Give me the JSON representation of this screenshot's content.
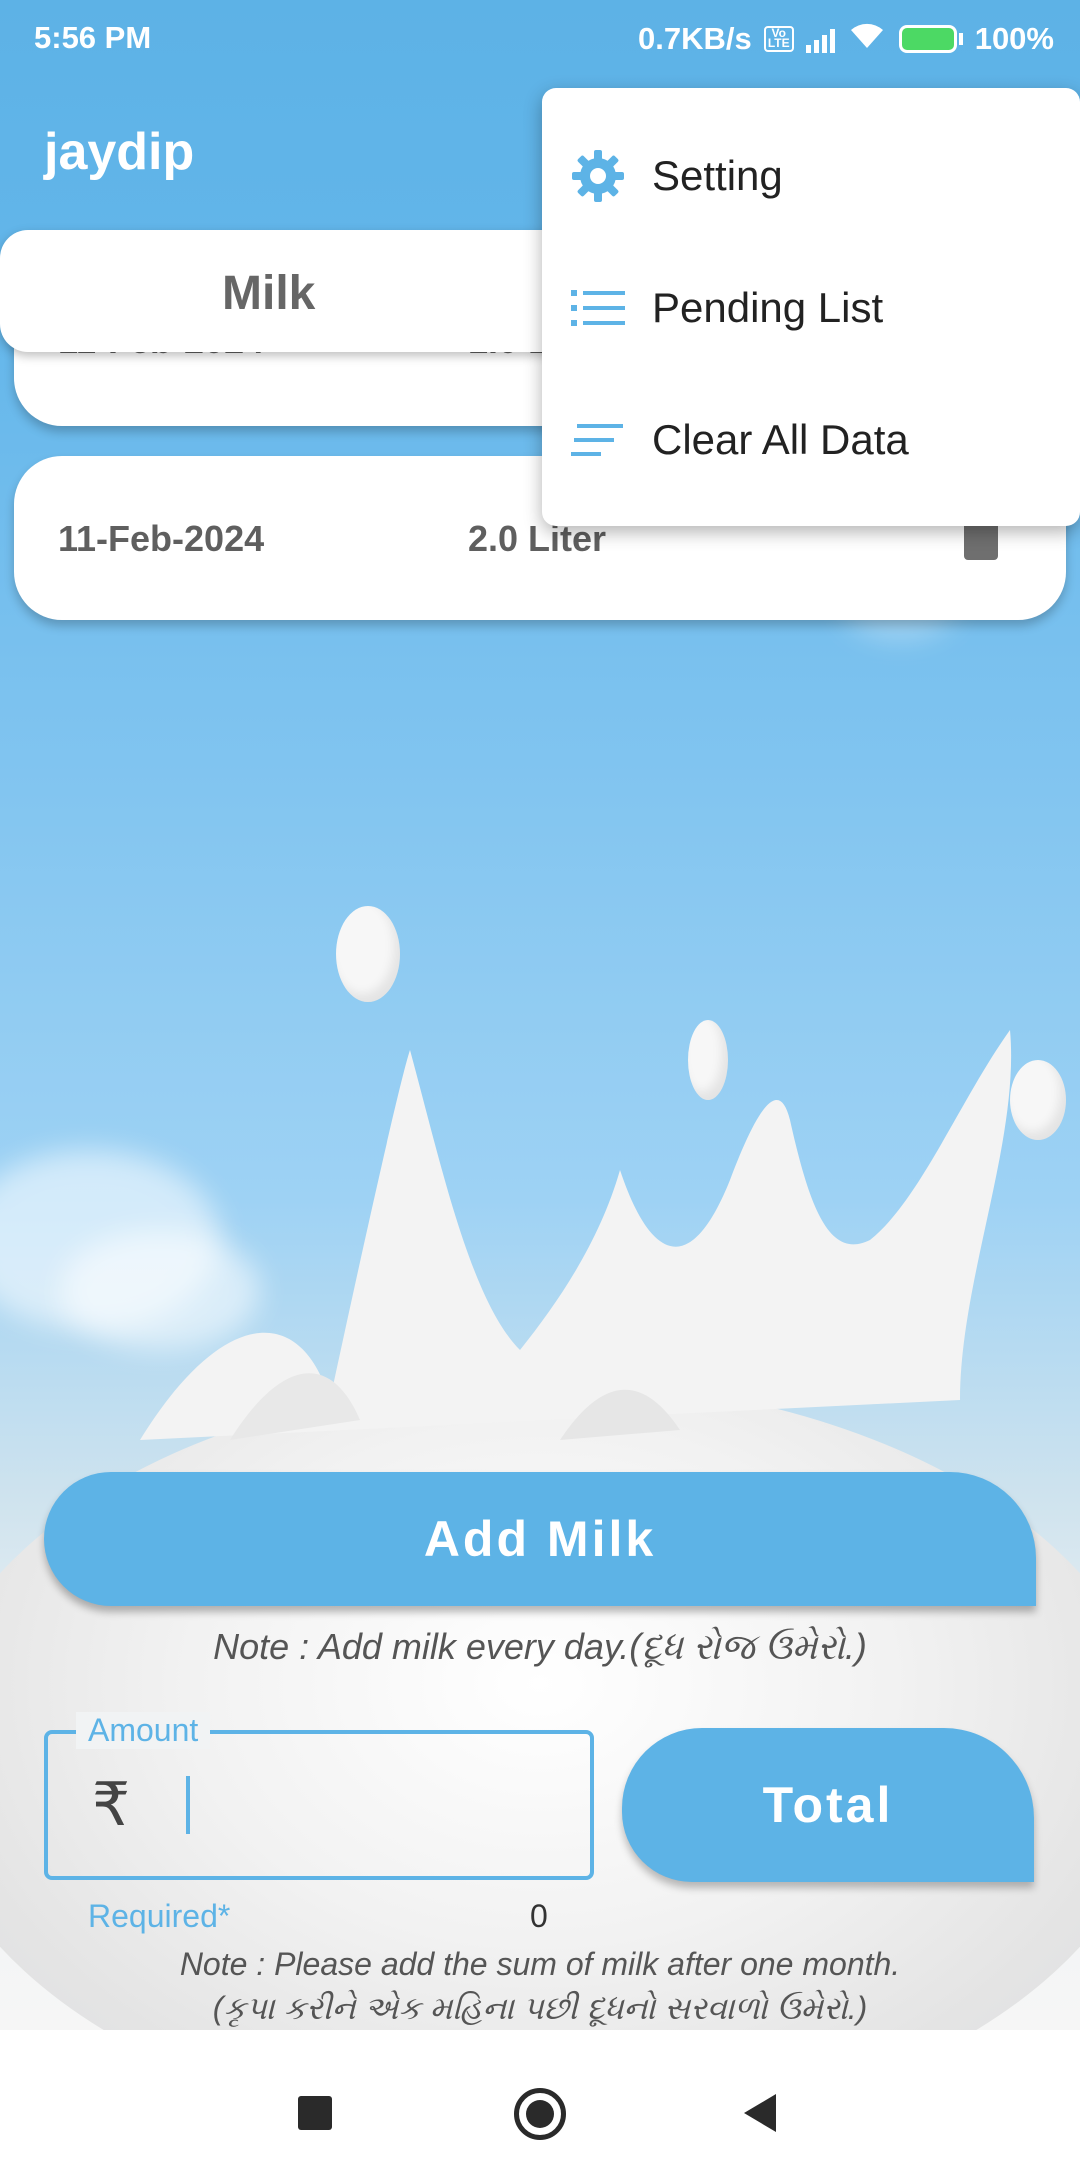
{
  "status_bar": {
    "time": "5:56 PM",
    "network_speed": "0.7KB/s",
    "battery": "100%"
  },
  "app_bar": {
    "title": "jaydip"
  },
  "tabs": {
    "active": "Milk"
  },
  "entries": [
    {
      "date": "11-Feb-2024",
      "quantity": "1.0 Liter"
    },
    {
      "date": "11-Feb-2024",
      "quantity": "2.0 Liter"
    }
  ],
  "overflow_menu": {
    "items": [
      {
        "label": "Setting",
        "icon": "gear-icon"
      },
      {
        "label": "Pending List",
        "icon": "list-icon"
      },
      {
        "label": "Clear All Data",
        "icon": "clear-lines-icon"
      }
    ]
  },
  "actions": {
    "add_milk_label": "Add Milk",
    "note_add": "Note : Add milk every day.(દૂધ રોજ ઉમેરો.)",
    "amount_label": "Amount",
    "currency_symbol": "₹",
    "amount_value": "",
    "total_label": "Total",
    "required_label": "Required*",
    "total_value": "0",
    "note_sum_line1": "Note : Please add the sum of milk after one month.",
    "note_sum_line2": "(કૃપા કરીને એક મહિના પછી દૂધનો સરવાળો ઉમેરો.)"
  },
  "colors": {
    "accent": "#5db3e6",
    "text_dark": "#5f5f5f"
  },
  "nav_bar": {
    "buttons": [
      "recents",
      "home",
      "back"
    ]
  }
}
